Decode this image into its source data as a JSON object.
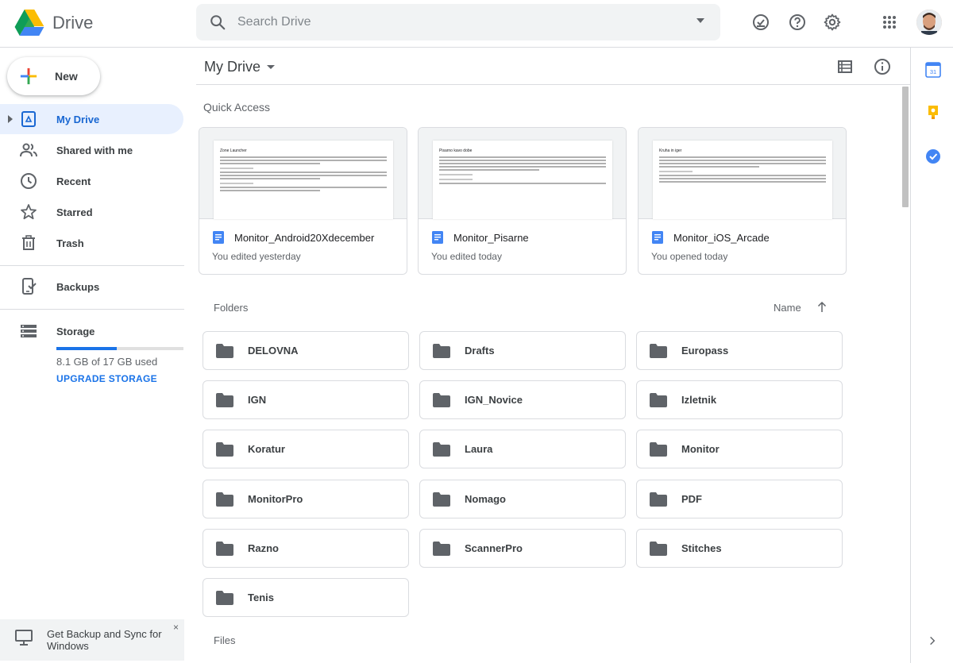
{
  "app": {
    "name": "Drive"
  },
  "search": {
    "placeholder": "Search Drive"
  },
  "sidebar": {
    "new_label": "New",
    "items": [
      {
        "label": "My Drive"
      },
      {
        "label": "Shared with me"
      },
      {
        "label": "Recent"
      },
      {
        "label": "Starred"
      },
      {
        "label": "Trash"
      },
      {
        "label": "Backups"
      },
      {
        "label": "Storage"
      }
    ],
    "storage_used": "8.1 GB of 17 GB used",
    "storage_fraction": 0.476,
    "upgrade_label": "UPGRADE STORAGE",
    "backup_promo": "Get Backup and Sync for Windows",
    "close_glyph": "×"
  },
  "main": {
    "title": "My Drive",
    "quick_access_label": "Quick Access",
    "quick_access": [
      {
        "name": "Monitor_Android20Xdecember",
        "sub": "You edited yesterday",
        "preview_title": "Zone Launcher"
      },
      {
        "name": "Monitor_Pisarne",
        "sub": "You edited today",
        "preview_title": "Pisarno kavo dobe"
      },
      {
        "name": "Monitor_iOS_Arcade",
        "sub": "You opened today",
        "preview_title": "Kruha in iger"
      }
    ],
    "folders_label": "Folders",
    "sort_label": "Name",
    "folders": [
      "DELOVNA",
      "Drafts",
      "Europass",
      "IGN",
      "IGN_Novice",
      "Izletnik",
      "Koratur",
      "Laura",
      "Monitor",
      "MonitorPro",
      "Nomago",
      "PDF",
      "Razno",
      "ScannerPro",
      "Stitches",
      "Tenis"
    ],
    "files_label": "Files"
  },
  "colors": {
    "accent": "#1a73e8",
    "active_bg": "#e8f0fe",
    "folder_icon": "#5f6368",
    "doc_icon": "#4285f4"
  }
}
